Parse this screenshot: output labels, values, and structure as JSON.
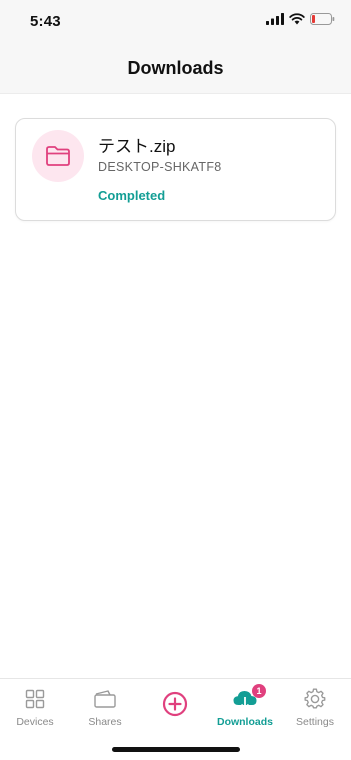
{
  "status_bar": {
    "time": "5:43"
  },
  "header": {
    "title": "Downloads"
  },
  "downloads": [
    {
      "name": "テスト.zip",
      "device": "DESKTOP-SHKATF8",
      "status": "Completed",
      "icon": "folder-icon"
    }
  ],
  "tabs": [
    {
      "label": "Devices",
      "icon": "devices-grid-icon",
      "active": false
    },
    {
      "label": "Shares",
      "icon": "shares-icon",
      "active": false
    },
    {
      "label": "",
      "icon": "add-circle-icon",
      "active": false
    },
    {
      "label": "Downloads",
      "icon": "cloud-download-icon",
      "active": true,
      "badge": "1"
    },
    {
      "label": "Settings",
      "icon": "gear-icon",
      "active": false
    }
  ],
  "colors": {
    "accent": "#139e95",
    "brand_pink": "#e0407e",
    "avatar_bg": "#fde6ef"
  }
}
